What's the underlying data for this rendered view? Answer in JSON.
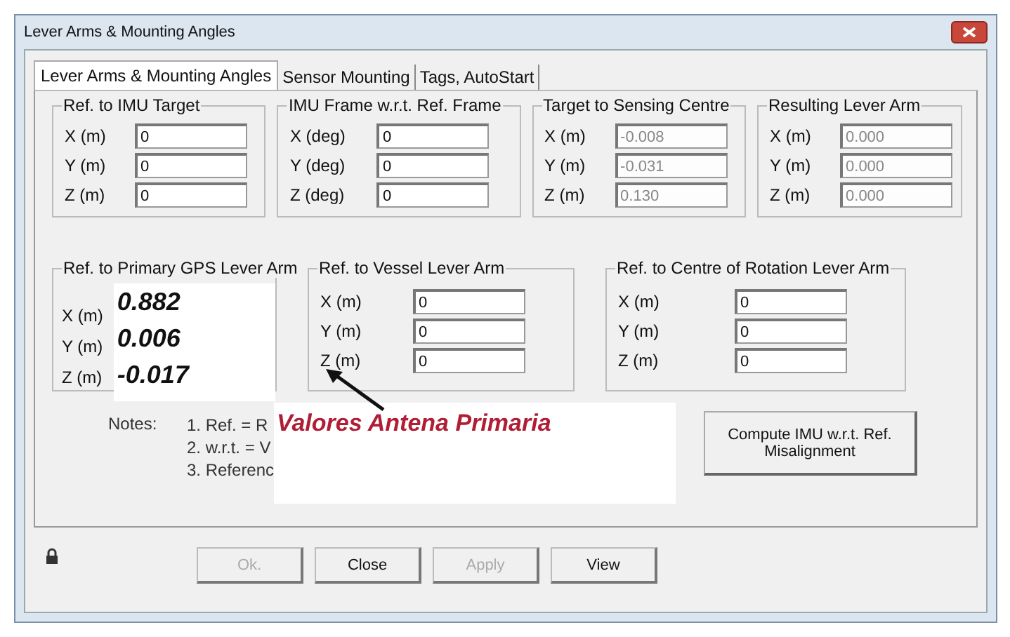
{
  "window": {
    "title": "Lever Arms & Mounting Angles"
  },
  "tabs": [
    {
      "label": "Lever Arms & Mounting Angles",
      "selected": true
    },
    {
      "label": "Sensor Mounting",
      "selected": false
    },
    {
      "label": "Tags, AutoStart",
      "selected": false
    }
  ],
  "groups_top": [
    {
      "title": "Ref. to IMU Target",
      "fields": [
        {
          "label": "X (m)",
          "value": "0",
          "disabled": false
        },
        {
          "label": "Y (m)",
          "value": "0",
          "disabled": false
        },
        {
          "label": "Z (m)",
          "value": "0",
          "disabled": false
        }
      ]
    },
    {
      "title": "IMU Frame w.r.t. Ref. Frame",
      "fields": [
        {
          "label": "X (deg)",
          "value": "0",
          "disabled": false
        },
        {
          "label": "Y (deg)",
          "value": "0",
          "disabled": false
        },
        {
          "label": "Z (deg)",
          "value": "0",
          "disabled": false
        }
      ]
    },
    {
      "title": "Target to Sensing Centre",
      "fields": [
        {
          "label": "X (m)",
          "value": "-0.008",
          "disabled": true
        },
        {
          "label": "Y (m)",
          "value": "-0.031",
          "disabled": true
        },
        {
          "label": "Z (m)",
          "value": "0.130",
          "disabled": true
        }
      ]
    },
    {
      "title": "Resulting Lever Arm",
      "fields": [
        {
          "label": "X (m)",
          "value": "0.000",
          "disabled": true
        },
        {
          "label": "Y (m)",
          "value": "0.000",
          "disabled": true
        },
        {
          "label": "Z (m)",
          "value": "0.000",
          "disabled": true
        }
      ]
    }
  ],
  "gps_group": {
    "title": "Ref. to Primary GPS Lever Arm",
    "rows": [
      {
        "label": "X (m)",
        "value": "0.882"
      },
      {
        "label": "Y (m)",
        "value": "0.006"
      },
      {
        "label": "Z (m)",
        "value": "-0.017"
      }
    ]
  },
  "groups_bottom": [
    {
      "title": "Ref. to Vessel Lever Arm",
      "fields": [
        {
          "label": "X (m)",
          "value": "0",
          "disabled": false
        },
        {
          "label": "Y (m)",
          "value": "0",
          "disabled": false
        },
        {
          "label": "Z (m)",
          "value": "0",
          "disabled": false
        }
      ]
    },
    {
      "title": "Ref. to Centre of Rotation Lever Arm",
      "fields": [
        {
          "label": "X (m)",
          "value": "0",
          "disabled": false
        },
        {
          "label": "Y (m)",
          "value": "0",
          "disabled": false
        },
        {
          "label": "Z (m)",
          "value": "0",
          "disabled": false
        }
      ]
    }
  ],
  "notes": {
    "label": "Notes:",
    "lines": [
      "1. Ref. = R",
      "2. w.r.t. = V",
      "3. Referenc"
    ]
  },
  "annotation": {
    "text": "Valores Antena Primaria"
  },
  "compute_button": {
    "label": "Compute IMU w.r.t. Ref. Misalignment"
  },
  "buttons": [
    {
      "label": "Ok.",
      "disabled": true
    },
    {
      "label": "Close",
      "disabled": false
    },
    {
      "label": "Apply",
      "disabled": true
    },
    {
      "label": "View",
      "disabled": false
    }
  ]
}
